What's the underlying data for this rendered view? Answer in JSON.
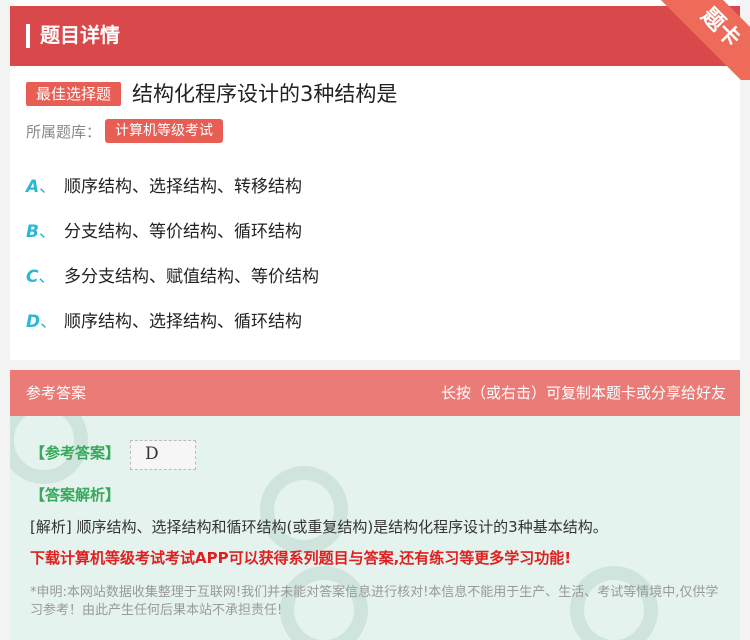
{
  "header": {
    "title": "题目详情",
    "corner": "题卡"
  },
  "question": {
    "type_badge": "最佳选择题",
    "title": "结构化程序设计的3种结构是",
    "bank_label": "所属题库：",
    "bank_name": "计算机等级考试"
  },
  "options": [
    {
      "letter": "A",
      "sep": "、",
      "text": "顺序结构、选择结构、转移结构"
    },
    {
      "letter": "B",
      "sep": "、",
      "text": "分支结构、等价结构、循环结构"
    },
    {
      "letter": "C",
      "sep": "、",
      "text": "多分支结构、赋值结构、等价结构"
    },
    {
      "letter": "D",
      "sep": "、",
      "text": "顺序结构、选择结构、循环结构"
    }
  ],
  "answer_section": {
    "header_left": "参考答案",
    "header_right": "长按（或右击）可复制本题卡或分享给好友",
    "ref_answer_label": "【参考答案】",
    "ref_answer_value": "D",
    "analysis_label": "【答案解析】",
    "analysis_text": "[解析] 顺序结构、选择结构和循环结构(或重复结构)是结构化程序设计的3种基本结构。",
    "promo_text": "下载计算机等级考试考试APP可以获得系列题目与答案,还有练习等更多学习功能!",
    "disclaimer": "*申明:本网站数据收集整理于互联网!我们并未能对答案信息进行核对!本信息不能用于生产、生活、考试等情境中,仅供学习参考！由此产生任何后果本站不承担责任!"
  },
  "colors": {
    "header_red": "#d9494b",
    "badge_red": "#e85d54",
    "answer_header": "#ea7b77",
    "answer_bg": "#e4f3ee",
    "option_letter": "#2bb7d6",
    "green_label": "#38a85a",
    "promo_red": "#e02020"
  }
}
